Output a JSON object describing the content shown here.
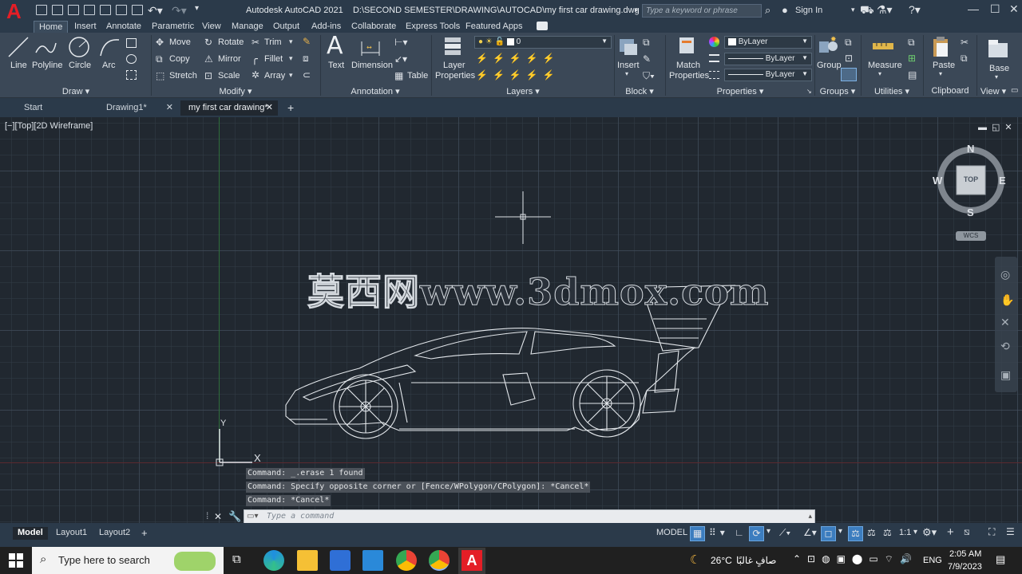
{
  "titlebar": {
    "app_title": "Autodesk AutoCAD 2021",
    "file_path": "D:\\SECOND SEMESTER\\DRAWING\\AUTOCAD\\my first car drawing.dwg",
    "search_placeholder": "Type a keyword or phrase",
    "sign_in": "Sign In",
    "logo": "A"
  },
  "menu": [
    "Home",
    "Insert",
    "Annotate",
    "Parametric",
    "View",
    "Manage",
    "Output",
    "Add-ins",
    "Collaborate",
    "Express Tools",
    "Featured Apps"
  ],
  "ribbon": {
    "draw": {
      "title": "Draw",
      "line": "Line",
      "polyline": "Polyline",
      "circle": "Circle",
      "arc": "Arc"
    },
    "modify": {
      "title": "Modify",
      "move": "Move",
      "rotate": "Rotate",
      "trim": "Trim",
      "copy": "Copy",
      "mirror": "Mirror",
      "fillet": "Fillet",
      "stretch": "Stretch",
      "scale": "Scale",
      "array": "Array"
    },
    "annotation": {
      "title": "Annotation",
      "text": "Text",
      "dimension": "Dimension",
      "table": "Table",
      "text_glyph": "A"
    },
    "layers": {
      "title": "Layers",
      "layer_properties_1": "Layer",
      "layer_properties_2": "Properties",
      "current_layer": "0"
    },
    "block": {
      "title": "Block",
      "insert": "Insert"
    },
    "properties": {
      "title": "Properties",
      "match_1": "Match",
      "match_2": "Properties",
      "color": "ByLayer",
      "linetype": "ByLayer",
      "lineweight": "ByLayer"
    },
    "groups": {
      "title": "Groups",
      "group": "Group"
    },
    "utilities": {
      "title": "Utilities",
      "measure": "Measure"
    },
    "clipboard": {
      "title": "Clipboard",
      "paste": "Paste"
    },
    "view": {
      "title": "View",
      "base": "Base"
    }
  },
  "doctabs": [
    "Start",
    "Drawing1*",
    "my first car drawing*"
  ],
  "viewport": {
    "label": "[−][Top][2D Wireframe]",
    "viewcube_top": "TOP",
    "compass_n": "N",
    "compass_s": "S",
    "compass_e": "E",
    "compass_w": "W",
    "wcs": "WCS",
    "ucs_y": "Y",
    "ucs_x": "X"
  },
  "watermark": "莫西网www.3dmox.com",
  "command_history": [
    "Command: _.erase 1 found",
    "Command: Specify opposite corner or [Fence/WPolygon/CPolygon]: *Cancel*",
    "Command: *Cancel*"
  ],
  "command_placeholder": "Type a command",
  "layout_tabs": [
    "Model",
    "Layout1",
    "Layout2"
  ],
  "status": {
    "model": "MODEL",
    "scale": "1:1"
  },
  "taskbar": {
    "search": "Type here to search",
    "weather": "26°C",
    "weather_text": "صافٍ غالبًا",
    "lang": "ENG",
    "time": "2:05 AM",
    "date": "7/9/2023"
  },
  "colors": {
    "accent": "#e41e26",
    "ribbon": "#3b4857",
    "canvas": "#212830"
  }
}
